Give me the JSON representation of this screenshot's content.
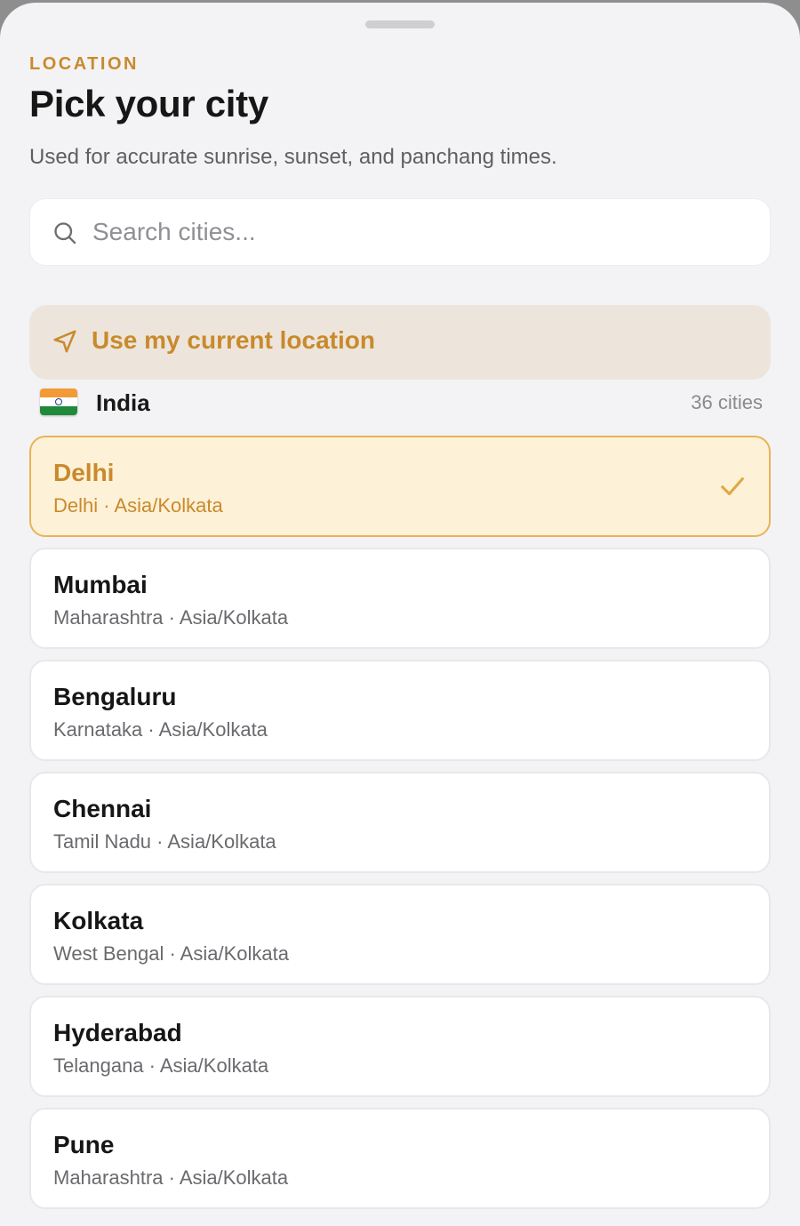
{
  "header": {
    "eyebrow": "LOCATION",
    "title": "Pick your city",
    "subtitle": "Used for accurate sunrise, sunset, and panchang times."
  },
  "search": {
    "placeholder": "Search cities...",
    "value": "",
    "icon": "search-icon"
  },
  "current_location": {
    "label": "Use my current location",
    "icon": "navigation-arrow-icon"
  },
  "country": {
    "flag": "india-flag",
    "name": "India",
    "count_label": "36 cities"
  },
  "cities": [
    {
      "name": "Delhi",
      "meta": "Delhi · Asia/Kolkata",
      "selected": true
    },
    {
      "name": "Mumbai",
      "meta": "Maharashtra · Asia/Kolkata",
      "selected": false
    },
    {
      "name": "Bengaluru",
      "meta": "Karnataka · Asia/Kolkata",
      "selected": false
    },
    {
      "name": "Chennai",
      "meta": "Tamil Nadu · Asia/Kolkata",
      "selected": false
    },
    {
      "name": "Kolkata",
      "meta": "West Bengal · Asia/Kolkata",
      "selected": false
    },
    {
      "name": "Hyderabad",
      "meta": "Telangana · Asia/Kolkata",
      "selected": false
    },
    {
      "name": "Pune",
      "meta": "Maharashtra · Asia/Kolkata",
      "selected": false
    }
  ],
  "colors": {
    "accent": "#c98a2c",
    "selected_bg": "#fdf1d7",
    "selected_border": "#e8b455",
    "location_bg": "#ede5dc",
    "sheet_bg": "#f3f3f5"
  }
}
